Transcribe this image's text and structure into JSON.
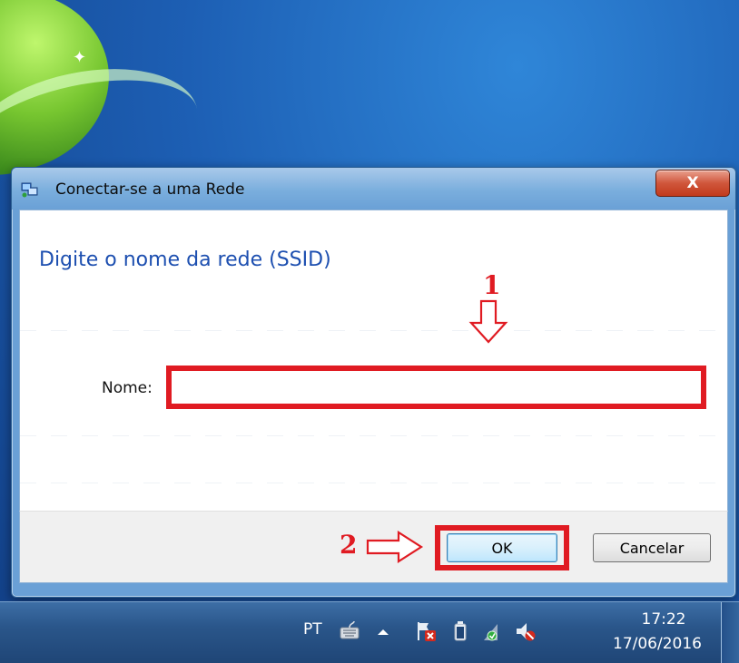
{
  "dialog": {
    "title": "Conectar-se a uma Rede",
    "close_label": "X",
    "heading": "Digite o nome da rede (SSID)",
    "name_label": "Nome:",
    "name_value": "",
    "ok_label": "OK",
    "cancel_label": "Cancelar"
  },
  "annotations": {
    "step1": "1",
    "step2": "2",
    "highlight_color": "#e01b22"
  },
  "taskbar": {
    "language": "PT",
    "time": "17:22",
    "date": "17/06/2016",
    "tray_icons": [
      "keyboard-icon",
      "show-hidden-icons-icon",
      "action-center-icon",
      "battery-icon",
      "network-icon",
      "volume-muted-icon"
    ]
  }
}
